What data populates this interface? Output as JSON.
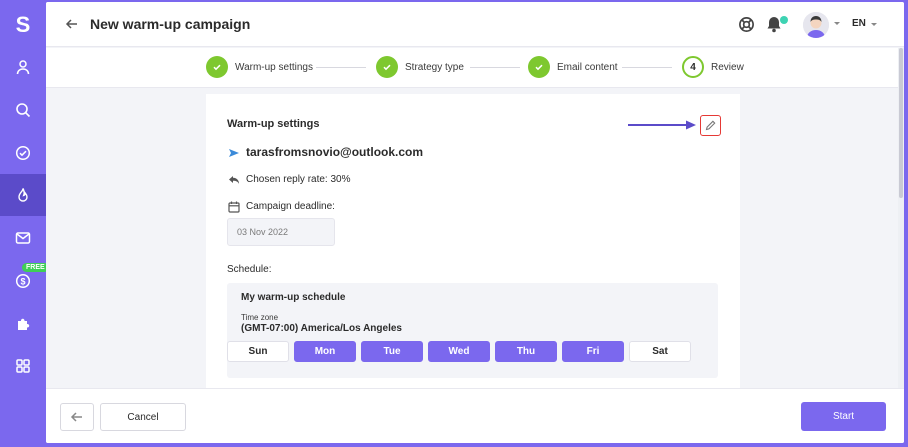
{
  "app": {
    "logo_letter": "S"
  },
  "sidebar": {
    "items": [
      {
        "icon": "user-icon"
      },
      {
        "icon": "search-icon"
      },
      {
        "icon": "check-circle-icon"
      },
      {
        "icon": "flame-icon",
        "active": true
      },
      {
        "icon": "mail-icon"
      },
      {
        "icon": "dollar-icon",
        "badge": "FREE"
      },
      {
        "icon": "puzzle-icon"
      },
      {
        "icon": "grid-icon"
      }
    ]
  },
  "header": {
    "title": "New warm-up campaign",
    "language": "EN"
  },
  "steps": [
    {
      "label": "Warm-up settings",
      "status": "done"
    },
    {
      "label": "Strategy type",
      "status": "done"
    },
    {
      "label": "Email content",
      "status": "done"
    },
    {
      "label": "Review",
      "number": "4",
      "status": "current"
    }
  ],
  "review": {
    "title": "Warm-up settings",
    "email": "tarasfromsnovio@outlook.com",
    "reply_rate": "Chosen reply rate: 30%",
    "deadline_label": "Campaign deadline:",
    "deadline_value": "03 Nov 2022",
    "schedule_label": "Schedule:",
    "schedule": {
      "name": "My warm-up schedule",
      "timezone_label": "Time zone",
      "timezone_value": "(GMT-07:00) America/Los Angeles",
      "days": [
        {
          "label": "Sun",
          "selected": false
        },
        {
          "label": "Mon",
          "selected": true
        },
        {
          "label": "Tue",
          "selected": true
        },
        {
          "label": "Wed",
          "selected": true
        },
        {
          "label": "Thu",
          "selected": true
        },
        {
          "label": "Fri",
          "selected": true
        },
        {
          "label": "Sat",
          "selected": false
        }
      ]
    }
  },
  "footer": {
    "cancel_label": "Cancel",
    "start_label": "Start"
  },
  "colors": {
    "accent": "#7b68ee",
    "success": "#7ec82f",
    "highlight": "#e53935"
  }
}
